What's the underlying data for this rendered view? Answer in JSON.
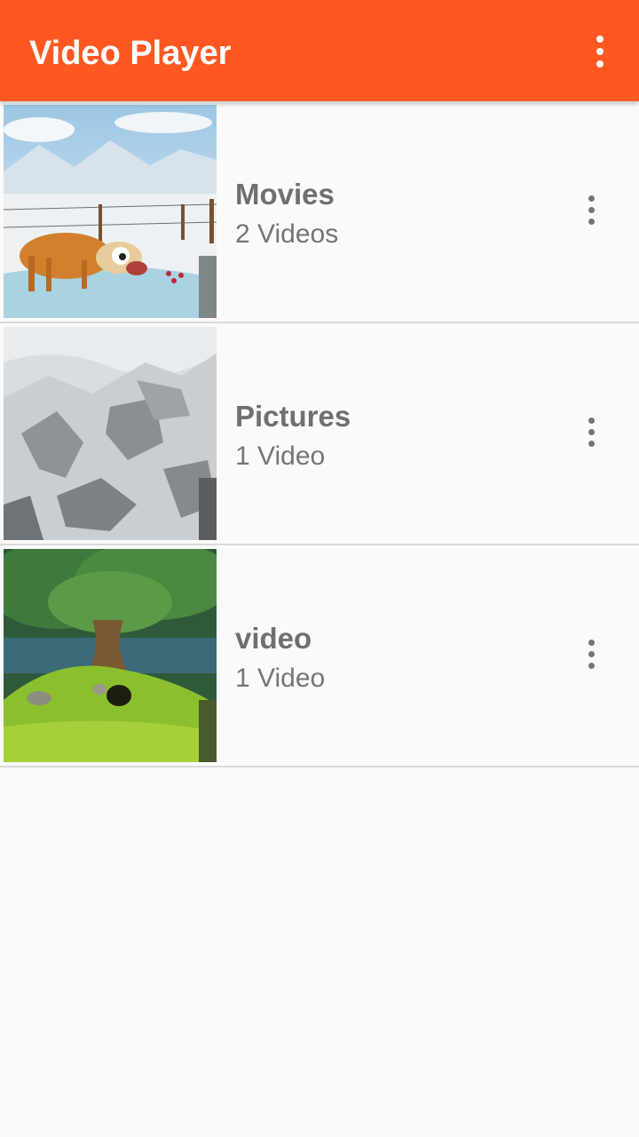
{
  "app_bar": {
    "title": "Video Player",
    "menu_icon": "more-vert-icon",
    "color": "#ff5722"
  },
  "folders": [
    {
      "name": "Movies",
      "count": "2 Videos",
      "thumbnail": "snowy-fence-deer-cartoon",
      "menu_icon": "more-vert-icon"
    },
    {
      "name": "Pictures",
      "count": "1 Video",
      "thumbnail": "snowy-mountain-cliff",
      "menu_icon": "more-vert-icon"
    },
    {
      "name": "video",
      "count": "1 Video",
      "thumbnail": "grassy-hill-tree-burrow",
      "menu_icon": "more-vert-icon"
    }
  ]
}
